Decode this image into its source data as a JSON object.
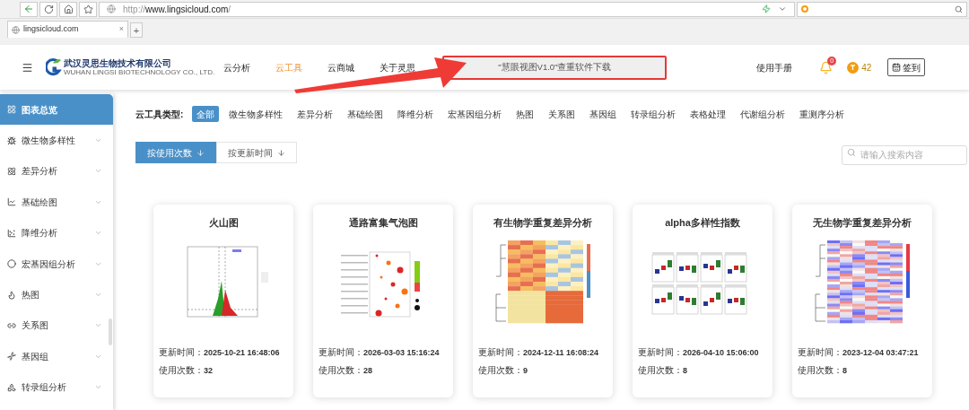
{
  "browser": {
    "url_scheme": "http://",
    "url_host": "www.lingsicloud.com",
    "url_path": "/",
    "tab": {
      "title": "lingsicloud.com",
      "close": "×"
    },
    "new_tab": "+"
  },
  "header": {
    "company_cn": "武汉灵思生物技术有限公司",
    "company_en": "WUHAN LINGSI BIOTECHNOLOGY CO., LTD.",
    "nav": [
      {
        "label": "云分析",
        "selected": false
      },
      {
        "label": "云工具",
        "selected": true
      },
      {
        "label": "云商城",
        "selected": false
      },
      {
        "label": "关于灵思",
        "selected": false
      }
    ],
    "announcement": "\"慧眼视图V1.0\"查重软件下载",
    "manual": "使用手册",
    "notifications": "0",
    "coins": "42",
    "checkin": "签到"
  },
  "sidebar": {
    "items": [
      {
        "label": "图表总览",
        "selected": true
      },
      {
        "label": "微生物多样性",
        "selected": false
      },
      {
        "label": "差异分析",
        "selected": false
      },
      {
        "label": "基础绘图",
        "selected": false
      },
      {
        "label": "降维分析",
        "selected": false
      },
      {
        "label": "宏基因组分析",
        "selected": false
      },
      {
        "label": "热图",
        "selected": false
      },
      {
        "label": "关系图",
        "selected": false
      },
      {
        "label": "基因组",
        "selected": false
      },
      {
        "label": "转录组分析",
        "selected": false
      }
    ]
  },
  "filter": {
    "label": "云工具类型:",
    "categories": [
      {
        "label": "全部",
        "selected": true
      },
      {
        "label": "微生物多样性",
        "selected": false
      },
      {
        "label": "差异分析",
        "selected": false
      },
      {
        "label": "基础绘图",
        "selected": false
      },
      {
        "label": "降维分析",
        "selected": false
      },
      {
        "label": "宏基因组分析",
        "selected": false
      },
      {
        "label": "热图",
        "selected": false
      },
      {
        "label": "关系图",
        "selected": false
      },
      {
        "label": "基因组",
        "selected": false
      },
      {
        "label": "转录组分析",
        "selected": false
      },
      {
        "label": "表格处理",
        "selected": false
      },
      {
        "label": "代谢组分析",
        "selected": false
      },
      {
        "label": "重测序分析",
        "selected": false
      }
    ]
  },
  "sort": [
    {
      "label": "按使用次数",
      "selected": true
    },
    {
      "label": "按更新时间",
      "selected": false
    }
  ],
  "search": {
    "placeholder": "请输入搜索内容"
  },
  "cards": [
    {
      "title": "火山图",
      "kind": "volcano",
      "updated_label": "更新时间：",
      "updated": "2025-10-21 16:48:06",
      "count_label": "使用次数：",
      "count": "32"
    },
    {
      "title": "通路富集气泡图",
      "kind": "bubble",
      "updated_label": "更新时间：",
      "updated": "2026-03-03 15:16:24",
      "count_label": "使用次数：",
      "count": "28"
    },
    {
      "title": "有生物学重复差异分析",
      "kind": "heatmap",
      "updated_label": "更新时间：",
      "updated": "2024-12-11 16:08:24",
      "count_label": "使用次数：",
      "count": "9"
    },
    {
      "title": "alpha多样性指数",
      "kind": "boxplot",
      "updated_label": "更新时间：",
      "updated": "2026-04-10 15:06:00",
      "count_label": "使用次数：",
      "count": "8"
    },
    {
      "title": "无生物学重复差异分析",
      "kind": "heatmap2",
      "updated_label": "更新时间：",
      "updated": "2023-12-04 03:47:21",
      "count_label": "使用次数：",
      "count": "8"
    }
  ]
}
